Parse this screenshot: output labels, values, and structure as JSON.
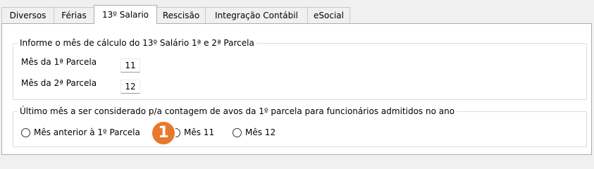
{
  "tabs": [
    {
      "label": "Diversos"
    },
    {
      "label": "Férias"
    },
    {
      "label": "13º Salario"
    },
    {
      "label": "Rescisão"
    },
    {
      "label": "Integração Contábil"
    },
    {
      "label": "eSocial"
    }
  ],
  "active_tab": "13º Salario",
  "group_parcelas": {
    "legend": "Informe o mês de cálculo do 13º Salário 1ª e 2ª Parcela",
    "first": {
      "label": "Mês da 1ª Parcela",
      "value": "11"
    },
    "second": {
      "label": "Mês da 2ª Parcela",
      "value": "12"
    }
  },
  "group_avos": {
    "legend": "Último mês a ser considerado p/a contagem de avos da 1º parcela para funcionários admitidos no ano",
    "options": [
      {
        "label": "Mês anterior à 1º Parcela",
        "selected": false
      },
      {
        "label": "Mês 11",
        "selected": false
      },
      {
        "label": "Mês 12",
        "selected": false
      }
    ]
  },
  "annotation": {
    "number": "1",
    "color": "#e8782d"
  }
}
